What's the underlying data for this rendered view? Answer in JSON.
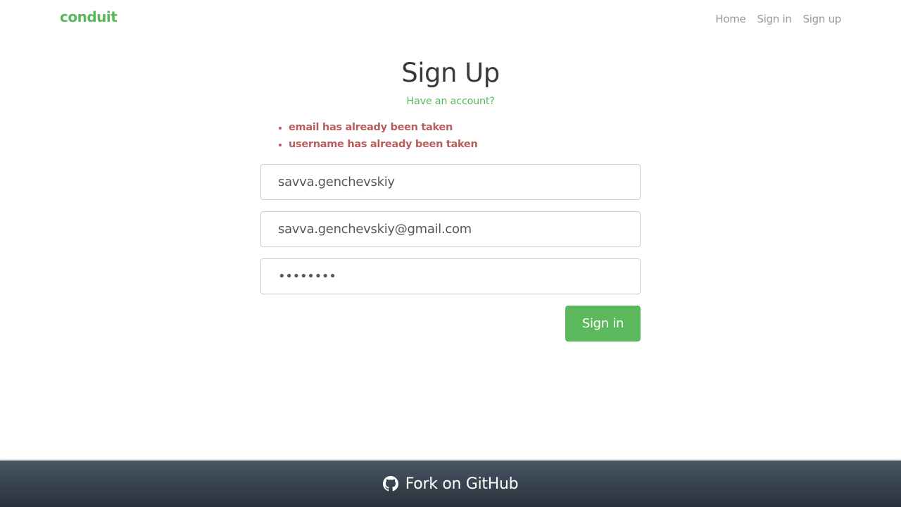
{
  "nav": {
    "brand": "conduit",
    "links": [
      "Home",
      "Sign in",
      "Sign up"
    ]
  },
  "auth": {
    "title": "Sign Up",
    "have_account_link": "Have an account?",
    "errors": [
      "email has already been taken",
      "username has already been taken"
    ],
    "fields": {
      "username_value": "savva.genchevskiy",
      "email_value": "savva.genchevskiy@gmail.com",
      "password_value": "••••••••"
    },
    "submit_label": "Sign in"
  },
  "footer": {
    "icon": "github-icon",
    "label": "Fork on GitHub"
  },
  "colors": {
    "brand": "#5cb85c",
    "error": "#b85c5c",
    "footer_top": "#485563",
    "footer_bottom": "#29323c"
  }
}
